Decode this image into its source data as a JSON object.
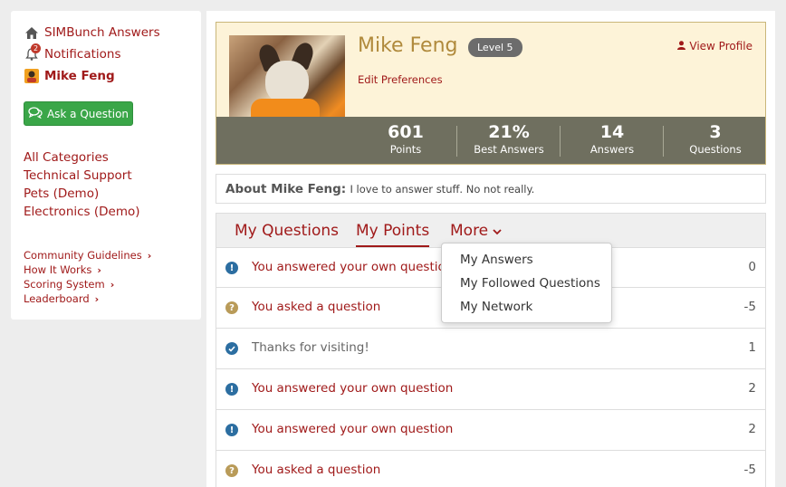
{
  "sidebar": {
    "site_name": "SIMBunch Answers",
    "notifications_label": "Notifications",
    "notifications_count": "2",
    "user_name": "Mike Feng",
    "ask_button": "Ask a Question",
    "categories": [
      "All Categories",
      "Technical Support",
      "Pets (Demo)",
      "Electronics (Demo)"
    ],
    "links": [
      "Community Guidelines",
      "How It Works",
      "Scoring System",
      "Leaderboard"
    ]
  },
  "profile": {
    "name": "Mike Feng",
    "level": "Level 5",
    "view_profile": "View Profile",
    "edit_preferences": "Edit Preferences",
    "stats": [
      {
        "value": "601",
        "label": "Points"
      },
      {
        "value": "21%",
        "label": "Best Answers"
      },
      {
        "value": "14",
        "label": "Answers"
      },
      {
        "value": "3",
        "label": "Questions"
      }
    ]
  },
  "about": {
    "label": "About Mike Feng:",
    "text": "I love to answer stuff. No not really."
  },
  "tabs": [
    {
      "label": "My Questions"
    },
    {
      "label": "My Points"
    },
    {
      "label": "More"
    }
  ],
  "more_menu": [
    "My Answers",
    "My Followed Questions",
    "My Network"
  ],
  "points": [
    {
      "icon": "exclamation-icon",
      "text": "You answered your own question",
      "value": "0"
    },
    {
      "icon": "question-icon",
      "text": "You asked a question",
      "value": "-5"
    },
    {
      "icon": "check-icon",
      "text": "Thanks for visiting!",
      "value": "1"
    },
    {
      "icon": "exclamation-icon",
      "text": "You answered your own question",
      "value": "2"
    },
    {
      "icon": "exclamation-icon",
      "text": "You answered your own question",
      "value": "2"
    },
    {
      "icon": "question-icon",
      "text": "You asked a question",
      "value": "-5"
    }
  ],
  "colors": {
    "accent": "#a01a1a",
    "ask_button": "#3aa648",
    "profile_bg": "#fdf3d8",
    "stats_bar": "#6f6f5f",
    "level_badge": "#6c6c6c",
    "name_gold": "#b08a3c"
  }
}
